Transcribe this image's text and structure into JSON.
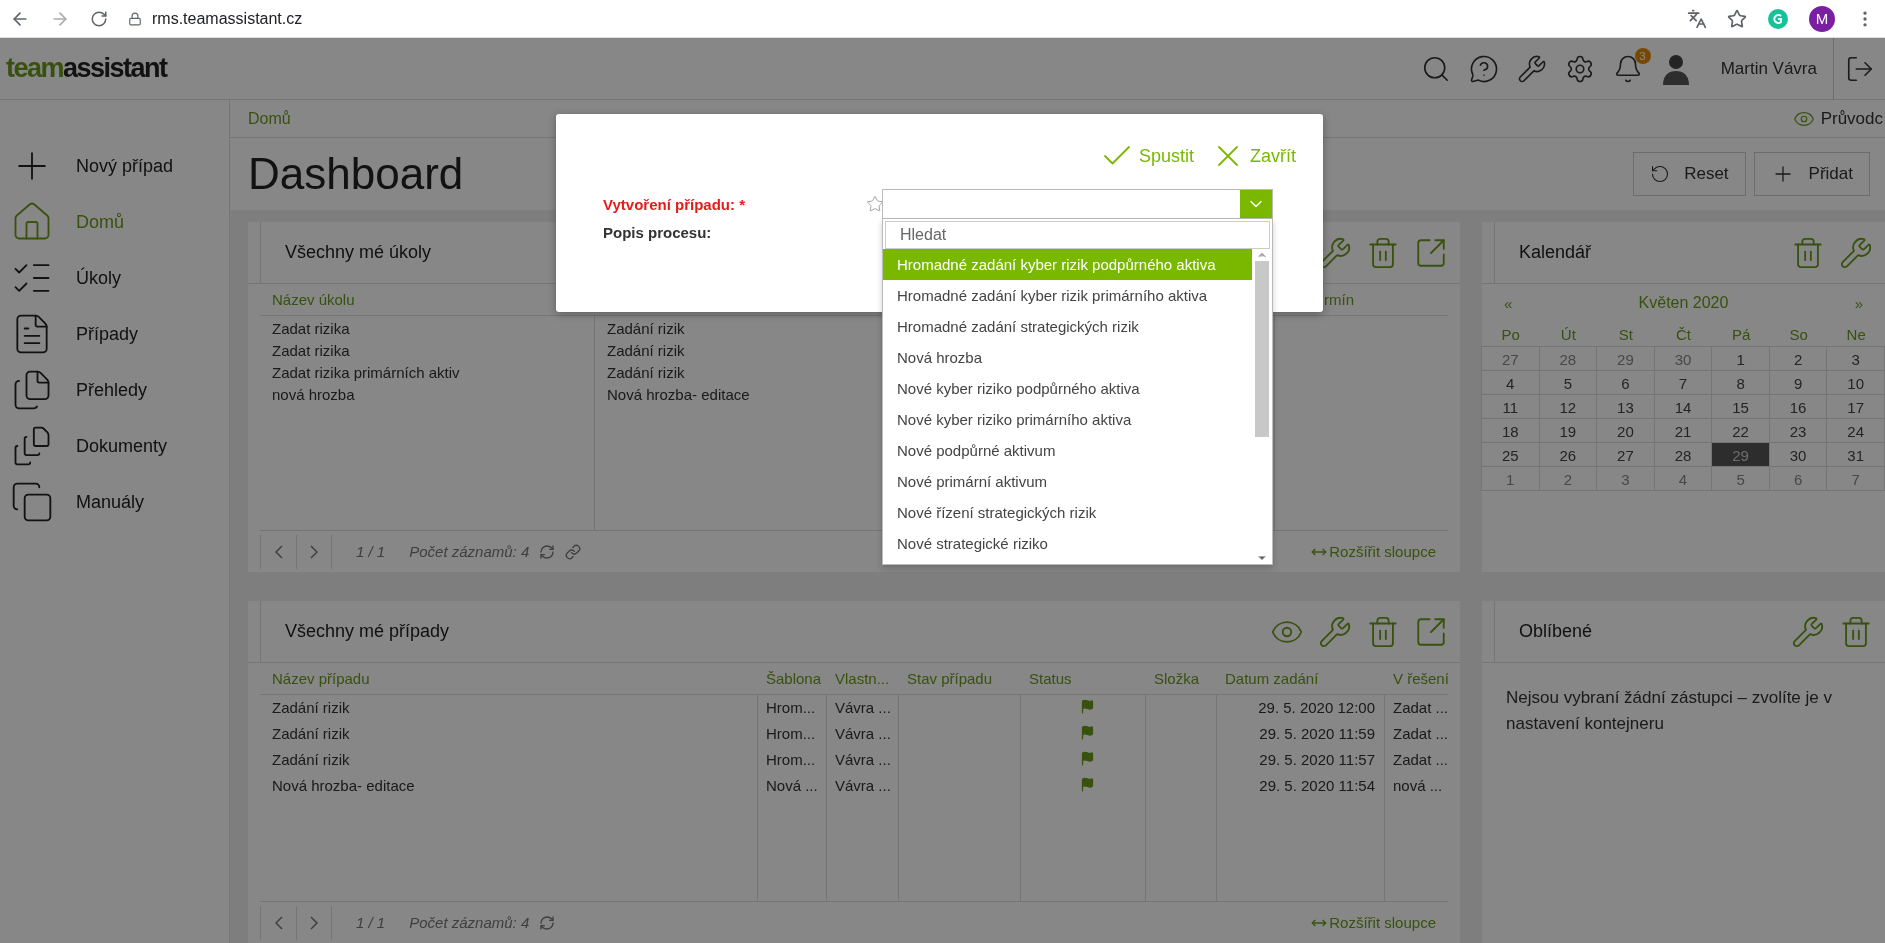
{
  "browser": {
    "url": "rms.teamassistant.cz",
    "profile_initial": "M"
  },
  "header": {
    "logo_first": "team",
    "logo_second": "assistant",
    "notification_count": "3",
    "user": "Martin Vávra"
  },
  "sidebar": {
    "items": [
      {
        "kind": "new",
        "label": "Nový případ",
        "selected": false
      },
      {
        "kind": "home",
        "label": "Domů",
        "selected": true
      },
      {
        "kind": "tasks",
        "label": "Úkoly",
        "selected": false
      },
      {
        "kind": "cases",
        "label": "Případy",
        "selected": false
      },
      {
        "kind": "reports",
        "label": "Přehledy",
        "selected": false
      },
      {
        "kind": "documents",
        "label": "Dokumenty",
        "selected": false
      },
      {
        "kind": "manuals",
        "label": "Manuály",
        "selected": false
      }
    ]
  },
  "breadcrumb": "Domů",
  "guide": "Průvodc",
  "title": "Dashboard",
  "actions": [
    {
      "kind": "reset",
      "label": "Reset"
    },
    {
      "kind": "add",
      "label": "Přidat"
    }
  ],
  "tasks_widget": {
    "title": "Všechny mé úkoly",
    "column_1": "Název úkolu",
    "column_3": "rmín",
    "rows": [
      [
        "Zadat rizika",
        "Zadání rizik"
      ],
      [
        "Zadat rizika",
        "Zadání rizik"
      ],
      [
        "Zadat rizika primárních aktiv",
        "Zadání rizik"
      ],
      [
        "nová hrozba",
        "Nová hrozba- editace"
      ]
    ],
    "footer": {
      "page": "1 / 1",
      "count": "Počet záznamů: 4",
      "expand": "Rozšířit sloupce"
    }
  },
  "calendar": {
    "title": "Kalendář",
    "prev": "«",
    "month": "Květen 2020",
    "next": "»",
    "weekdays": [
      "Po",
      "Út",
      "St",
      "Čt",
      "Pá",
      "So",
      "Ne"
    ],
    "weeks": [
      [
        {
          "label": "27",
          "outside": true,
          "selected": false
        },
        {
          "label": "28",
          "outside": true,
          "selected": false
        },
        {
          "label": "29",
          "outside": true,
          "selected": false
        },
        {
          "label": "30",
          "outside": true,
          "selected": false
        },
        {
          "label": "1",
          "outside": false,
          "selected": false
        },
        {
          "label": "2",
          "outside": false,
          "selected": false
        },
        {
          "label": "3",
          "outside": false,
          "selected": false
        }
      ],
      [
        {
          "label": "4",
          "outside": false,
          "selected": false
        },
        {
          "label": "5",
          "outside": false,
          "selected": false
        },
        {
          "label": "6",
          "outside": false,
          "selected": false
        },
        {
          "label": "7",
          "outside": false,
          "selected": false
        },
        {
          "label": "8",
          "outside": false,
          "selected": false
        },
        {
          "label": "9",
          "outside": false,
          "selected": false
        },
        {
          "label": "10",
          "outside": false,
          "selected": false
        }
      ],
      [
        {
          "label": "11",
          "outside": false,
          "selected": false
        },
        {
          "label": "12",
          "outside": false,
          "selected": false
        },
        {
          "label": "13",
          "outside": false,
          "selected": false
        },
        {
          "label": "14",
          "outside": false,
          "selected": false
        },
        {
          "label": "15",
          "outside": false,
          "selected": false
        },
        {
          "label": "16",
          "outside": false,
          "selected": false
        },
        {
          "label": "17",
          "outside": false,
          "selected": false
        }
      ],
      [
        {
          "label": "18",
          "outside": false,
          "selected": false
        },
        {
          "label": "19",
          "outside": false,
          "selected": false
        },
        {
          "label": "20",
          "outside": false,
          "selected": false
        },
        {
          "label": "21",
          "outside": false,
          "selected": false
        },
        {
          "label": "22",
          "outside": false,
          "selected": false
        },
        {
          "label": "23",
          "outside": false,
          "selected": false
        },
        {
          "label": "24",
          "outside": false,
          "selected": false
        }
      ],
      [
        {
          "label": "25",
          "outside": false,
          "selected": false
        },
        {
          "label": "26",
          "outside": false,
          "selected": false
        },
        {
          "label": "27",
          "outside": false,
          "selected": false
        },
        {
          "label": "28",
          "outside": false,
          "selected": false
        },
        {
          "label": "29",
          "outside": false,
          "selected": true
        },
        {
          "label": "30",
          "outside": false,
          "selected": false
        },
        {
          "label": "31",
          "outside": false,
          "selected": false
        }
      ],
      [
        {
          "label": "1",
          "outside": true,
          "selected": false
        },
        {
          "label": "2",
          "outside": true,
          "selected": false
        },
        {
          "label": "3",
          "outside": true,
          "selected": false
        },
        {
          "label": "4",
          "outside": true,
          "selected": false
        },
        {
          "label": "5",
          "outside": true,
          "selected": false
        },
        {
          "label": "6",
          "outside": true,
          "selected": false
        },
        {
          "label": "7",
          "outside": true,
          "selected": false
        }
      ]
    ]
  },
  "cases_widget": {
    "title": "Všechny mé případy",
    "columns": [
      "Název případu",
      "Šablona",
      "Vlastn...",
      "Stav případu",
      "Status",
      "Složka",
      "Datum zadání",
      "V řešení"
    ],
    "rows": [
      {
        "name": "Zadání rizik",
        "template": "Hrom...",
        "owner": "Vávra ...",
        "flagged": true,
        "date": "29. 5. 2020 12:00",
        "solving": "Zadat ..."
      },
      {
        "name": "Zadání rizik",
        "template": "Hrom...",
        "owner": "Vávra ...",
        "flagged": true,
        "date": "29. 5. 2020 11:59",
        "solving": "Zadat ..."
      },
      {
        "name": "Zadání rizik",
        "template": "Hrom...",
        "owner": "Vávra ...",
        "flagged": true,
        "date": "29. 5. 2020 11:57",
        "solving": "Zadat ..."
      },
      {
        "name": "Nová hrozba- editace",
        "template": "Nová ...",
        "owner": "Vávra ...",
        "flagged": true,
        "date": "29. 5. 2020 11:54",
        "solving": "nová ..."
      }
    ],
    "footer": {
      "page": "1 / 1",
      "count": "Počet záznamů: 4",
      "expand": "Rozšířit sloupce"
    }
  },
  "favorites": {
    "title": "Oblíbené",
    "message": "Nejsou vybraní žádní zástupci – zvolíte je v nastavení kontejneru"
  },
  "dialog": {
    "run": "Spustit",
    "close": "Zavřít",
    "field_label": "Vytvoření případu: *",
    "description_label": "Popis procesu:",
    "search_placeholder": "Hledat",
    "options": [
      {
        "label": "Hromadné zadání kyber rizik podpůrného aktiva",
        "selected": true
      },
      {
        "label": "Hromadné zadání kyber rizik primárního aktiva",
        "selected": false
      },
      {
        "label": "Hromadné zadání strategických rizik",
        "selected": false
      },
      {
        "label": "Nová hrozba",
        "selected": false
      },
      {
        "label": "Nové kyber riziko podpůrného aktiva",
        "selected": false
      },
      {
        "label": "Nové kyber riziko primárního aktiva",
        "selected": false
      },
      {
        "label": "Nové podpůrné aktivum",
        "selected": false
      },
      {
        "label": "Nové primární aktivum",
        "selected": false
      },
      {
        "label": "Nové řízení strategických rizik",
        "selected": false
      },
      {
        "label": "Nové strategické riziko",
        "selected": false
      }
    ]
  }
}
